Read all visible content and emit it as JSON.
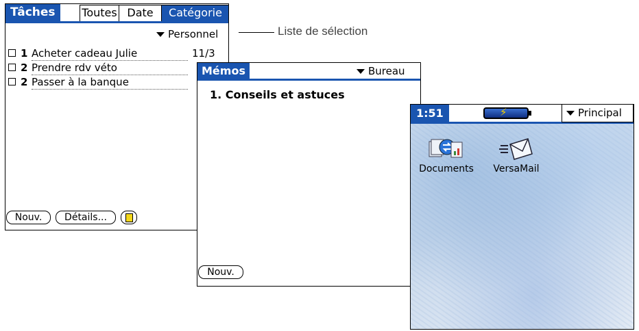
{
  "tasks": {
    "title": "Tâches",
    "tabs": [
      {
        "label": "Toutes",
        "selected": false
      },
      {
        "label": "Date",
        "selected": false
      },
      {
        "label": "Catégorie",
        "selected": true
      }
    ],
    "category_picker": "Personnel",
    "items": [
      {
        "priority": "1",
        "text": "Acheter cadeau Julie",
        "due": "11/3"
      },
      {
        "priority": "2",
        "text": "Prendre rdv véto",
        "due": ""
      },
      {
        "priority": "2",
        "text": "Passer à la banque",
        "due": ""
      }
    ],
    "buttons": {
      "new": "Nouv.",
      "details": "Détails..."
    }
  },
  "callout": {
    "label": "Liste de sélection"
  },
  "memos": {
    "title": "Mémos",
    "category_picker": "Bureau",
    "items": [
      {
        "text": "1. Conseils et astuces"
      }
    ],
    "buttons": {
      "new": "Nouv."
    }
  },
  "launcher": {
    "time": "1:51",
    "category_picker": "Principal",
    "apps": [
      {
        "label": "Documents",
        "icon": "documents-icon"
      },
      {
        "label": "VersaMail",
        "icon": "versamail-icon"
      }
    ]
  },
  "colors": {
    "accent": "#1a55b0",
    "note": "#f3d71a",
    "bolt": "#f4d000"
  }
}
